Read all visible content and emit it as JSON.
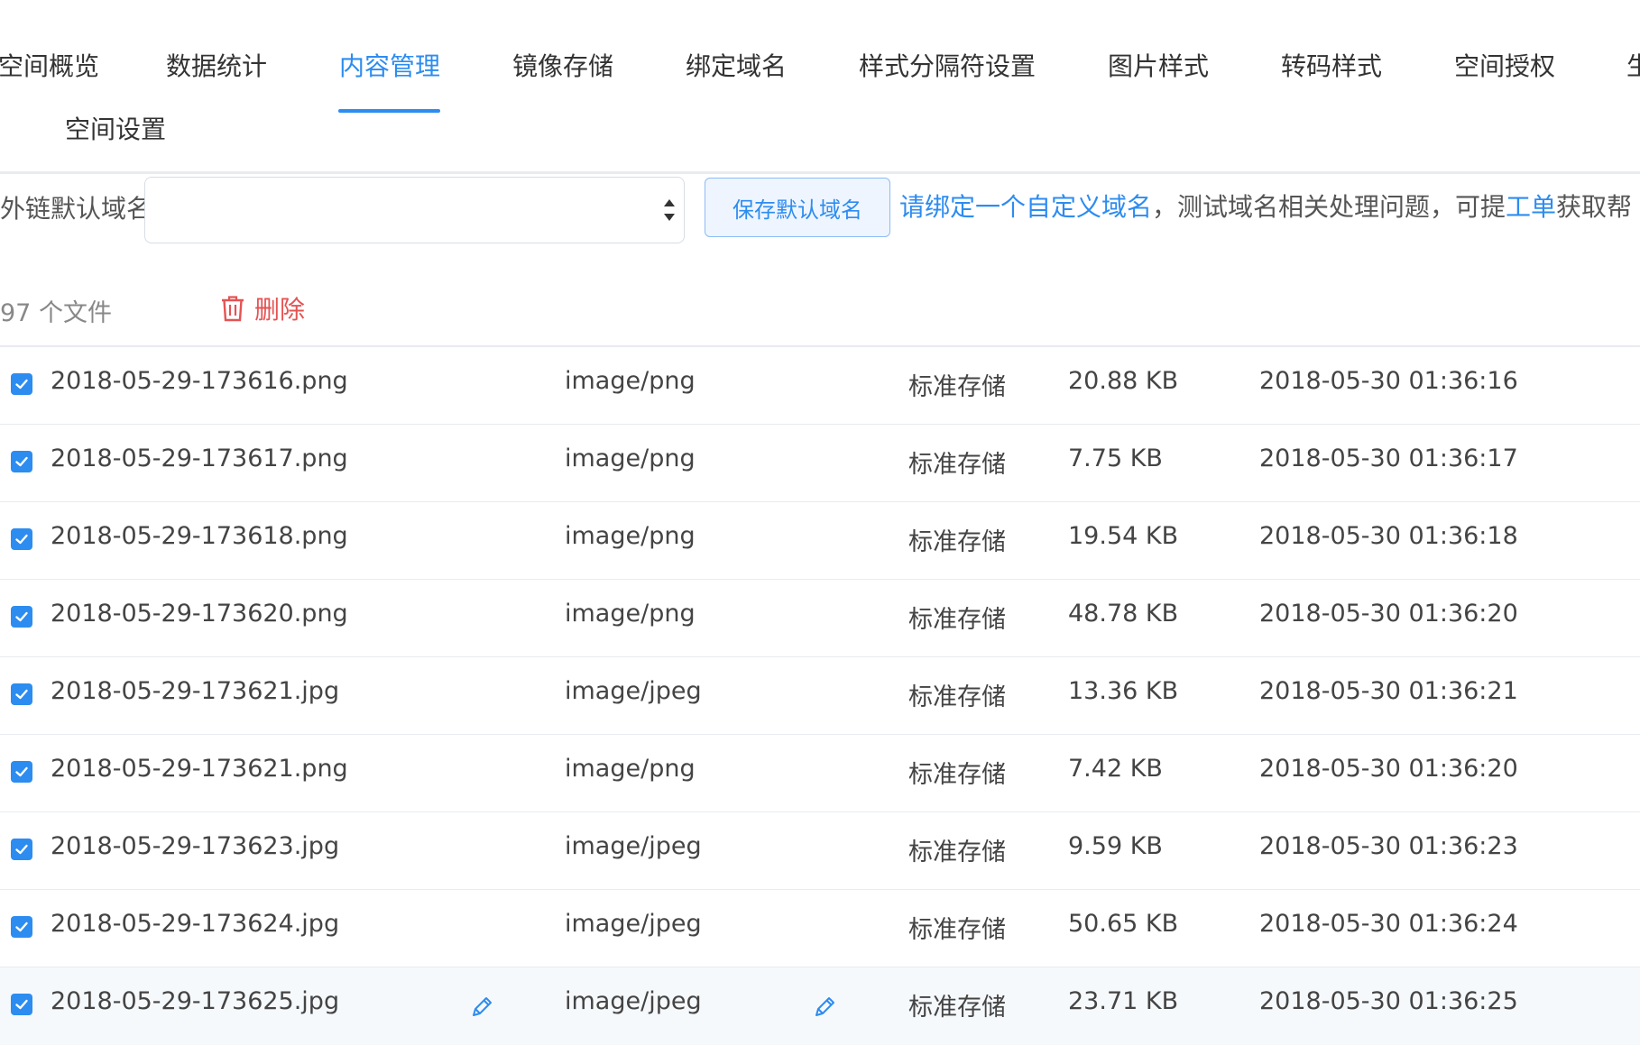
{
  "tabs": {
    "items": [
      {
        "label": "空间概览"
      },
      {
        "label": "数据统计"
      },
      {
        "label": "内容管理",
        "active": true
      },
      {
        "label": "镜像存储"
      },
      {
        "label": "绑定域名"
      },
      {
        "label": "样式分隔符设置"
      },
      {
        "label": "图片样式"
      },
      {
        "label": "转码样式"
      },
      {
        "label": "空间授权"
      },
      {
        "label": "生"
      },
      {
        "label": "空间设置"
      }
    ]
  },
  "domain": {
    "label": "外链默认域名",
    "select_value": "",
    "save_button": "保存默认域名",
    "msg_link": "请绑定一个自定义域名",
    "msg_middle": "，测试域名相关处理问题，可提",
    "msg_ticket_link": "工单",
    "msg_tail": "获取帮"
  },
  "toolbar": {
    "file_count": "97 个文件",
    "delete_label": "删除"
  },
  "files": [
    {
      "name": "2018-05-29-173616.png",
      "type": "image/png",
      "storage": "标准存储",
      "size": "20.88 KB",
      "time": "2018-05-30 01:36:16",
      "checked": true
    },
    {
      "name": "2018-05-29-173617.png",
      "type": "image/png",
      "storage": "标准存储",
      "size": "7.75 KB",
      "time": "2018-05-30 01:36:17",
      "checked": true
    },
    {
      "name": "2018-05-29-173618.png",
      "type": "image/png",
      "storage": "标准存储",
      "size": "19.54 KB",
      "time": "2018-05-30 01:36:18",
      "checked": true
    },
    {
      "name": "2018-05-29-173620.png",
      "type": "image/png",
      "storage": "标准存储",
      "size": "48.78 KB",
      "time": "2018-05-30 01:36:20",
      "checked": true
    },
    {
      "name": "2018-05-29-173621.jpg",
      "type": "image/jpeg",
      "storage": "标准存储",
      "size": "13.36 KB",
      "time": "2018-05-30 01:36:21",
      "checked": true
    },
    {
      "name": "2018-05-29-173621.png",
      "type": "image/png",
      "storage": "标准存储",
      "size": "7.42 KB",
      "time": "2018-05-30 01:36:20",
      "checked": true
    },
    {
      "name": "2018-05-29-173623.jpg",
      "type": "image/jpeg",
      "storage": "标准存储",
      "size": "9.59 KB",
      "time": "2018-05-30 01:36:23",
      "checked": true
    },
    {
      "name": "2018-05-29-173624.jpg",
      "type": "image/jpeg",
      "storage": "标准存储",
      "size": "50.65 KB",
      "time": "2018-05-30 01:36:24",
      "checked": true
    },
    {
      "name": "2018-05-29-173625.jpg",
      "type": "image/jpeg",
      "storage": "标准存储",
      "size": "23.71 KB",
      "time": "2018-05-30 01:36:25",
      "checked": true
    }
  ]
}
